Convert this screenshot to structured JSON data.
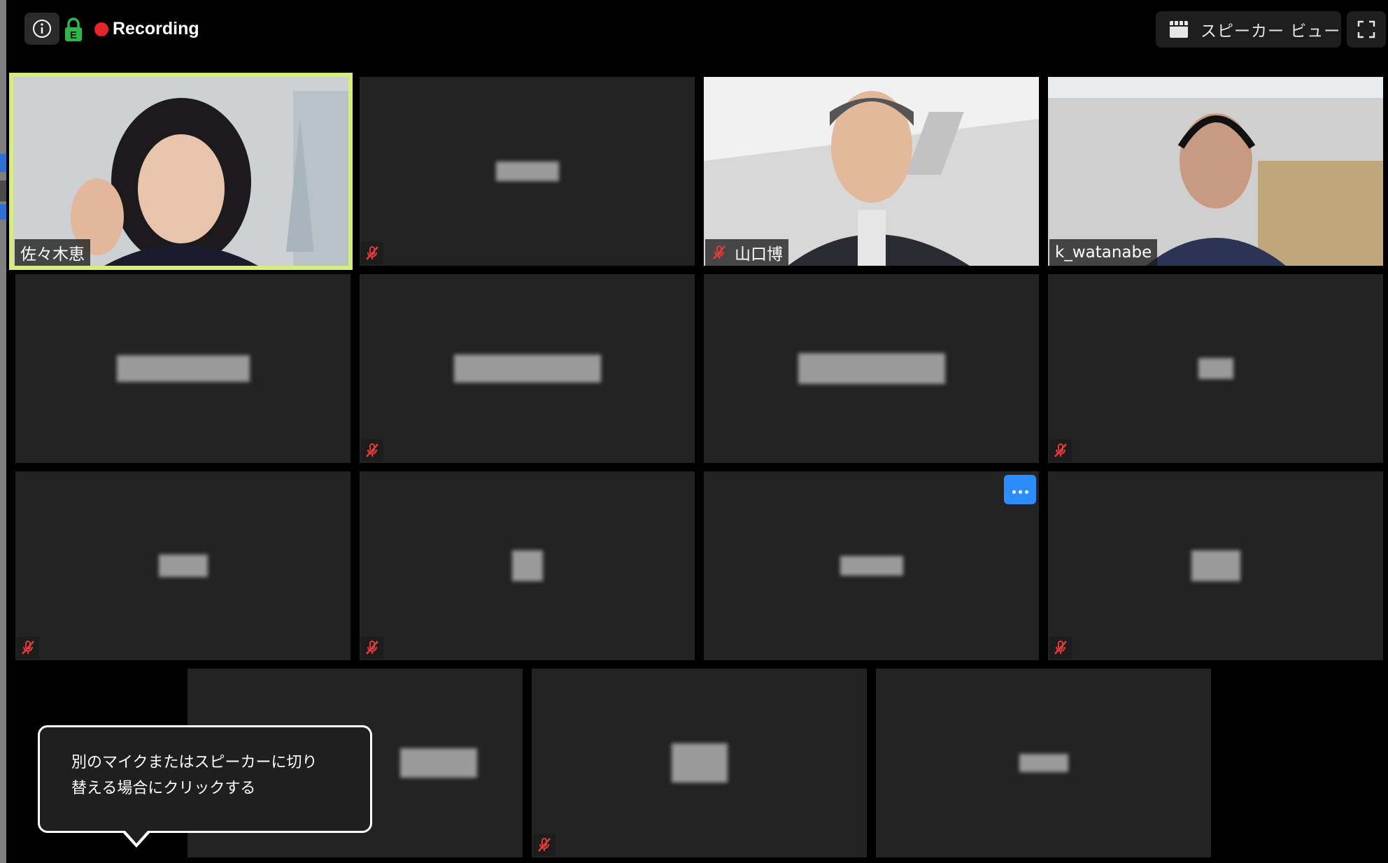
{
  "topbar": {
    "recording_label": "Recording",
    "lock_letter": "E",
    "view_button_label": "スピーカー ビュー"
  },
  "participants": [
    {
      "name": "佐々木恵",
      "muted": false,
      "video": true,
      "active": true
    },
    {
      "name": "",
      "muted": true,
      "video": false
    },
    {
      "name": "山口博",
      "muted": true,
      "video": true
    },
    {
      "name": "k_watanabe",
      "muted": false,
      "video": true
    },
    {
      "name": "",
      "muted": false,
      "video": false
    },
    {
      "name": "",
      "muted": true,
      "video": false
    },
    {
      "name": "",
      "muted": false,
      "video": false
    },
    {
      "name": "",
      "muted": true,
      "video": false
    },
    {
      "name": "",
      "muted": true,
      "video": false
    },
    {
      "name": "",
      "muted": true,
      "video": false
    },
    {
      "name": "",
      "muted": false,
      "video": false,
      "has_more_button": true
    },
    {
      "name": "",
      "muted": true,
      "video": false
    },
    {
      "name": "",
      "muted": false,
      "video": false
    },
    {
      "name": "",
      "muted": true,
      "video": false
    },
    {
      "name": "",
      "muted": false,
      "video": false
    }
  ],
  "tooltip": {
    "text_line1": "別のマイクまたはスピーカーに切り",
    "text_line2": "替える場合にクリックする"
  },
  "colors": {
    "background": "#000000",
    "tile": "#232323",
    "active_border": "#d6ec7e",
    "record_dot": "#e8242b",
    "lock_green": "#2db84b",
    "mute_red": "#e33b3b",
    "more_button": "#2d8cff"
  },
  "icons": {
    "info": "info-circle-icon",
    "lock": "encryption-lock-icon",
    "view": "grid-view-icon",
    "fullscreen": "fullscreen-icon",
    "mute": "mic-muted-icon",
    "more": "more-options-icon"
  }
}
